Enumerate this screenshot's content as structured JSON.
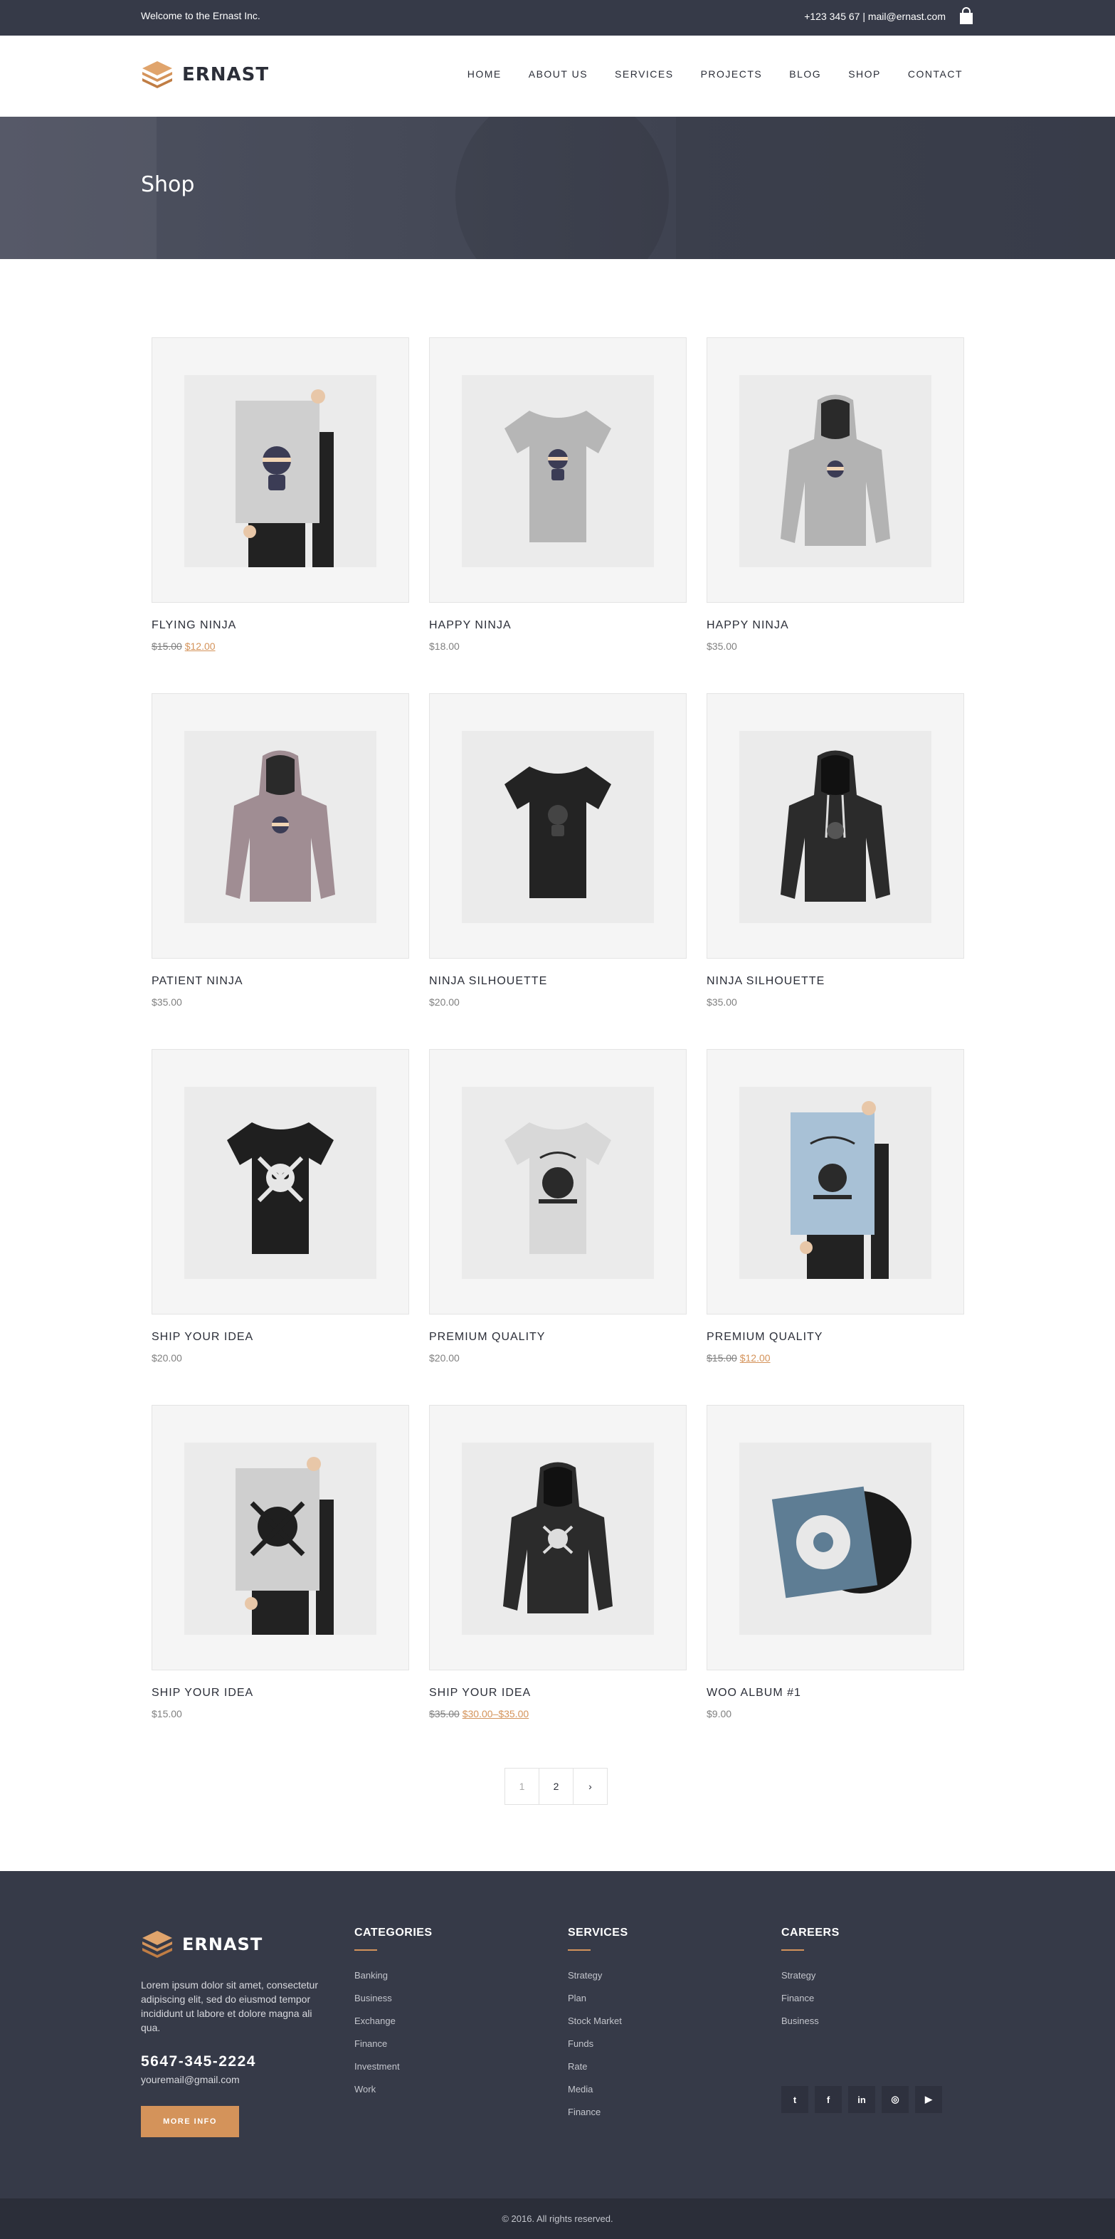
{
  "topbar": {
    "welcome": "Welcome to the Ernast Inc.",
    "contact": "+123 345 67 | mail@ernast.com",
    "cart_icon": "shopping-bag-icon"
  },
  "brand": {
    "name": "ERNAST",
    "logo_icon": "layered-stack-icon",
    "accent": "#d4935a",
    "dark": "#363a48"
  },
  "nav": [
    "HOME",
    "ABOUT US",
    "SERVICES",
    "PROJECTS",
    "BLOG",
    "SHOP",
    "CONTACT"
  ],
  "hero": {
    "title": "Shop"
  },
  "products": [
    {
      "title": "FLYING NINJA",
      "old_price": "$15.00",
      "price": "$12.00"
    },
    {
      "title": "HAPPY NINJA",
      "old_price": "",
      "price": "$18.00"
    },
    {
      "title": "HAPPY NINJA",
      "old_price": "",
      "price": "$35.00"
    },
    {
      "title": "PATIENT NINJA",
      "old_price": "",
      "price": "$35.00"
    },
    {
      "title": "NINJA SILHOUETTE",
      "old_price": "",
      "price": "$20.00"
    },
    {
      "title": "NINJA SILHOUETTE",
      "old_price": "",
      "price": "$35.00"
    },
    {
      "title": "SHIP YOUR IDEA",
      "old_price": "",
      "price": "$20.00"
    },
    {
      "title": "PREMIUM QUALITY",
      "old_price": "",
      "price": "$20.00"
    },
    {
      "title": "PREMIUM QUALITY",
      "old_price": "$15.00",
      "price": "$12.00"
    },
    {
      "title": "SHIP YOUR IDEA",
      "old_price": "",
      "price": "$15.00"
    },
    {
      "title": "SHIP YOUR IDEA",
      "old_price": "$35.00",
      "price": "$30.00–$35.00"
    },
    {
      "title": "WOO ALBUM #1",
      "old_price": "",
      "price": "$9.00"
    }
  ],
  "pagination": {
    "pages": [
      "1",
      "2"
    ],
    "next": "›"
  },
  "footer": {
    "about": "Lorem ipsum dolor sit amet, consectetur adipiscing elit, sed do eiusmod tempor incididunt ut labore et dolore magna ali qua.",
    "phone": "5647-345-2224",
    "email": "youremail@gmail.com",
    "more_info": "MORE INFO",
    "categories": {
      "title": "CATEGORIES",
      "items": [
        "Banking",
        "Business",
        "Exchange",
        "Finance",
        "Investment",
        "Work"
      ]
    },
    "services": {
      "title": "SERVICES",
      "items": [
        "Strategy",
        "Plan",
        "Stock Market",
        "Funds",
        "Rate",
        "Media",
        "Finance"
      ]
    },
    "careers": {
      "title": "CAREERS",
      "items": [
        "Strategy",
        "Finance",
        "Business"
      ]
    },
    "social": [
      {
        "icon": "twitter-icon",
        "glyph": "t"
      },
      {
        "icon": "facebook-icon",
        "glyph": "f"
      },
      {
        "icon": "linkedin-icon",
        "glyph": "in"
      },
      {
        "icon": "instagram-icon",
        "glyph": "◎"
      },
      {
        "icon": "youtube-icon",
        "glyph": "▶"
      }
    ],
    "copyright": "© 2016. All rights reserved."
  }
}
